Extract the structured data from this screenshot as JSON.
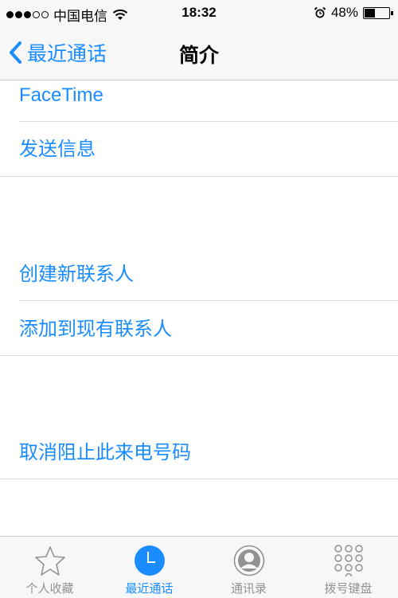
{
  "status_bar": {
    "carrier": "中国电信",
    "time": "18:32",
    "battery": "48%",
    "battery_level": 0.48,
    "signal_bars": 3,
    "signal_total": 5
  },
  "nav": {
    "back_label": "最近通话",
    "title": "简介"
  },
  "rows": [
    {
      "label": "FaceTime"
    },
    {
      "label": "发送信息"
    },
    {
      "label": "创建新联系人"
    },
    {
      "label": "添加到现有联系人"
    },
    {
      "label": "取消阻止此来电号码"
    }
  ],
  "tabs": [
    {
      "label": "个人收藏",
      "icon": "star-icon"
    },
    {
      "label": "最近通话",
      "icon": "clock-icon",
      "active": true
    },
    {
      "label": "通讯录",
      "icon": "contact-icon"
    },
    {
      "label": "拨号键盘",
      "icon": "keypad-icon"
    }
  ],
  "colors": {
    "accent": "#1a8cff",
    "inactive": "#929292",
    "bar_bg": "#f7f7f7",
    "group_bg": "#efeff4"
  }
}
